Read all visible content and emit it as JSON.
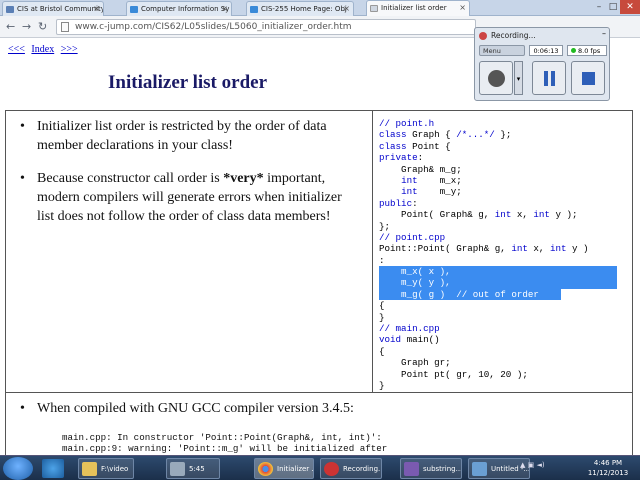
{
  "browser": {
    "tabs": [
      {
        "label": "CIS at Bristol Community"
      },
      {
        "label": "Computer Information Sy"
      },
      {
        "label": "CIS-255 Home Page: Obj"
      },
      {
        "label": "Initializer list order"
      }
    ],
    "url": "www.c-jump.com/CIS62/L05slides/L5060_initializer_order.htm",
    "window_buttons": {
      "minimize": "–",
      "maximize": "□",
      "close": "✕"
    }
  },
  "page": {
    "nav": {
      "prev": "<<<",
      "index": "Index",
      "next": ">>>"
    },
    "title": "Initializer list order",
    "bullet1": "Initializer list order is restricted by the order of data member declarations in your class!",
    "bullet2_pre": "Because constructor call order is ",
    "bullet2_em": "*very*",
    "bullet2_post": " important, modern compilers will generate errors when initializer list does not follow the order of class data members!",
    "code_lines": [
      "// point.h",
      "class Graph { /*...*/ };",
      "class Point {",
      "private:",
      "    Graph& m_g;",
      "    int    m_x;",
      "    int    m_y;",
      "public:",
      "    Point( Graph& g, int x, int y );",
      "};",
      "// point.cpp",
      "Point::Point( Graph& g, int x, int y )",
      ":",
      "    m_x( x ),",
      "    m_y( y ),",
      "    m_g( g )  // out of order",
      "{",
      "}",
      "// main.cpp",
      "void main()",
      "{",
      "    Graph gr;",
      "    Point pt( gr, 10, 20 );",
      "}"
    ],
    "compile_bullet": "When compiled with GNU GCC compiler version 3.4.5:",
    "compile_line1": "main.cpp: In constructor 'Point::Point(Graph&, int, int)':",
    "compile_line2": "main.cpp:9: warning: 'Point::m_g' will be initialized after"
  },
  "recorder": {
    "title": "Recording...",
    "menu": "Menu",
    "time": "0:06:13",
    "fps": "8.0 fps",
    "minimize": "–"
  },
  "taskbar": {
    "tasks": [
      {
        "label": "F:\\video"
      },
      {
        "label": "5:45"
      },
      {
        "label": "Initializer ..."
      },
      {
        "label": "Recording..."
      },
      {
        "label": "substring..."
      },
      {
        "label": "Untitled -..."
      }
    ],
    "clock_time": "4:46 PM",
    "clock_date": "11/12/2013"
  },
  "colors": {
    "selection": "#3b8cf0",
    "title_color": "#1a1a66",
    "link": "#0000cc",
    "code_keyword": "#0000cc"
  }
}
